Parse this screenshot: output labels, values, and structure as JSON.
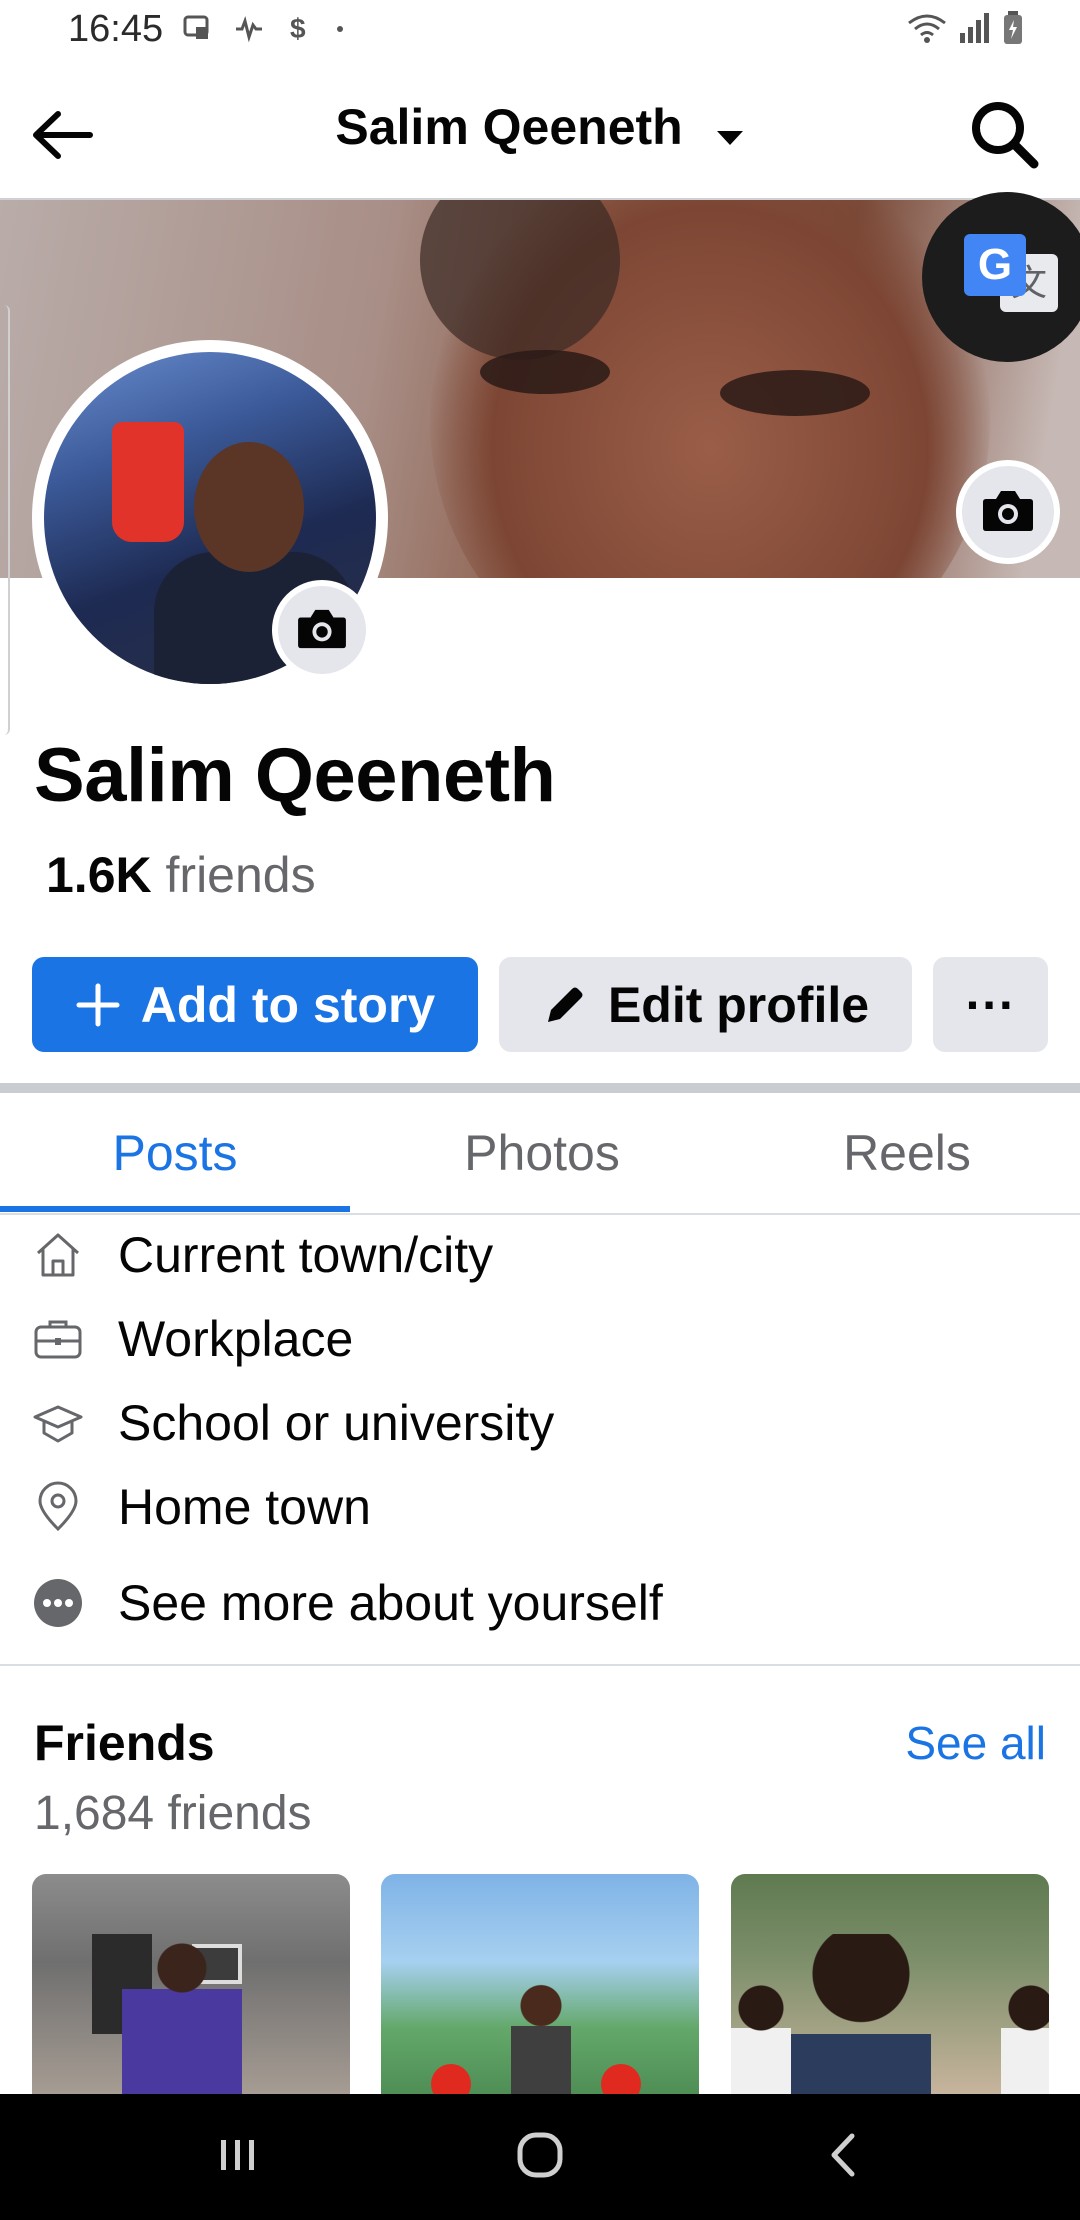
{
  "status_bar": {
    "time": "16:45",
    "left_icons": [
      "screen-icon",
      "activity-icon",
      "dollar-icon",
      "dot-icon"
    ],
    "right_icons": [
      "wifi-icon",
      "signal-icon",
      "battery-icon"
    ]
  },
  "app_bar": {
    "title": "Salim Qeeneth",
    "back_icon": "arrow-left-icon",
    "search_icon": "search-icon"
  },
  "profile": {
    "name": "Salim Qeeneth",
    "friends_count": "1.6K",
    "friends_label": "friends"
  },
  "actions": {
    "add_story": "Add to story",
    "edit_profile": "Edit profile",
    "more": "···"
  },
  "tabs": [
    {
      "label": "Posts",
      "active": true
    },
    {
      "label": "Photos",
      "active": false
    },
    {
      "label": "Reels",
      "active": false
    }
  ],
  "details": [
    {
      "icon": "home-icon",
      "label": "Current town/city"
    },
    {
      "icon": "briefcase-icon",
      "label": "Workplace"
    },
    {
      "icon": "graduation-cap-icon",
      "label": "School or university"
    },
    {
      "icon": "location-pin-icon",
      "label": "Home town"
    },
    {
      "icon": "more-circle-icon",
      "label": "See more about yourself"
    }
  ],
  "friends": {
    "title": "Friends",
    "see_all": "See all",
    "count_label": "1,684 friends"
  },
  "colors": {
    "accent": "#1b74e4",
    "secondary_button": "#e4e6eb",
    "muted_text": "#65676b"
  }
}
